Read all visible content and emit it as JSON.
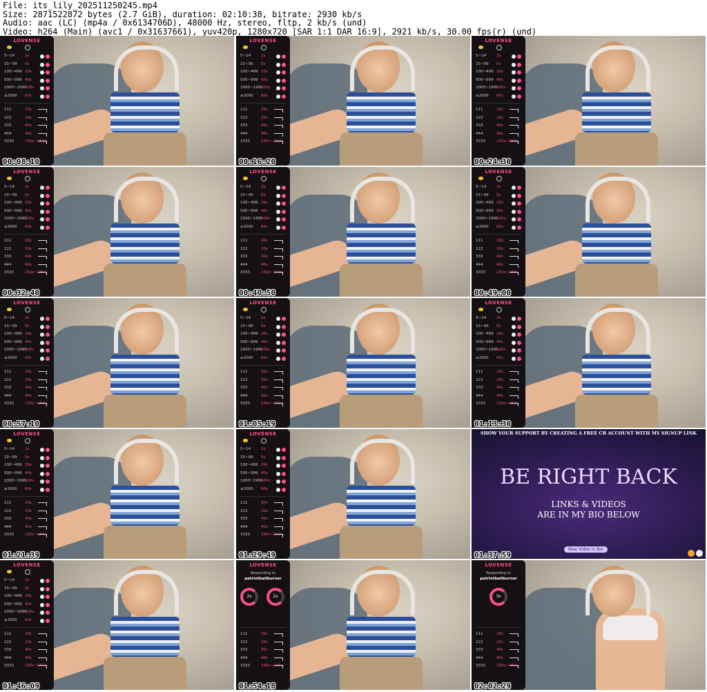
{
  "header": {
    "line1": "File: its_lily_202511250245.mp4",
    "line2": "Size: 2871522872 bytes (2.7 GiB), duration: 02:10:38, bitrate: 2930 kb/s",
    "line3": "Audio: aac (LC) (mp4a / 0x6134706D), 48000 Hz, stereo, fltp, 2 kb/s (und)",
    "line4": "Video: h264 (Main) (avc1 / 0x31637661), yuv420p, 1280x720 [SAR 1:1 DAR 16:9], 2921 kb/s, 30.00 fps(r) (und)"
  },
  "panel": {
    "brand": "LOVENSE",
    "tip_rows": [
      {
        "range": "5~14",
        "value": "2s"
      },
      {
        "range": "15~99",
        "value": "5s"
      },
      {
        "range": "100~499",
        "value": "20s"
      },
      {
        "range": "500~999",
        "value": "40s"
      },
      {
        "range": "1000~1999",
        "value": "100s"
      },
      {
        "range": "≥2000",
        "value": "60s"
      }
    ],
    "pattern_rows": [
      {
        "code": "111",
        "value": "20s"
      },
      {
        "code": "222",
        "value": "20s"
      },
      {
        "code": "333",
        "value": "40s"
      },
      {
        "code": "444",
        "value": "40s"
      },
      {
        "code": "3333",
        "value": "150s~150s"
      }
    ],
    "responding_label": "Responding to",
    "responding_user": "patriotballburner",
    "gauge_values": [
      "2s",
      "2s",
      "3s"
    ]
  },
  "brb": {
    "banner": "SHOW YOUR SUPPORT BY CREATING A FREE CB ACCOUNT WITH MY SIGNUP LINK",
    "title": "BE RIGHT BACK",
    "sub1": "LINKS & VIDEOS",
    "sub2": "ARE IN MY BIO BELOW",
    "pill": "New Video in Bio"
  },
  "thumbnails": [
    {
      "time": "00:08:10",
      "kind": "cam"
    },
    {
      "time": "00:16:20",
      "kind": "cam"
    },
    {
      "time": "00:24:30",
      "kind": "cam"
    },
    {
      "time": "00:32:40",
      "kind": "cam"
    },
    {
      "time": "00:40:50",
      "kind": "cam"
    },
    {
      "time": "00:49:00",
      "kind": "cam"
    },
    {
      "time": "00:57:10",
      "kind": "cam"
    },
    {
      "time": "01:05:19",
      "kind": "cam"
    },
    {
      "time": "01:13:30",
      "kind": "cam"
    },
    {
      "time": "01:21:39",
      "kind": "cam"
    },
    {
      "time": "01:29:49",
      "kind": "cam"
    },
    {
      "time": "01:37:59",
      "kind": "brb"
    },
    {
      "time": "01:46:09",
      "kind": "cam"
    },
    {
      "time": "01:54:18",
      "kind": "responding2"
    },
    {
      "time": "02:02:29",
      "kind": "responding1"
    }
  ]
}
